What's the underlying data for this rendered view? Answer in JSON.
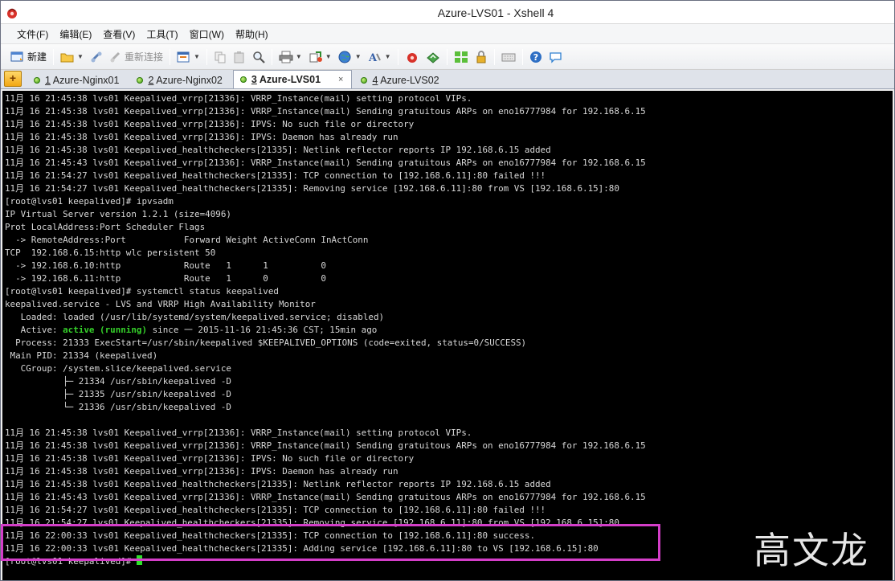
{
  "window": {
    "title": "Azure-LVS01 - Xshell 4"
  },
  "menu": [
    "文件(F)",
    "编辑(E)",
    "查看(V)",
    "工具(T)",
    "窗口(W)",
    "帮助(H)"
  ],
  "toolbar": {
    "new_label": "新建",
    "reconnect_label": "重新连接"
  },
  "tabs": [
    {
      "num": "1",
      "label": "Azure-Nginx01"
    },
    {
      "num": "2",
      "label": "Azure-Nginx02"
    },
    {
      "num": "3",
      "label": "Azure-LVS01",
      "active": true
    },
    {
      "num": "4",
      "label": "Azure-LVS02"
    }
  ],
  "tab_add_symbol": "+",
  "tab_close_symbol": "×",
  "terminal": {
    "lines": [
      "11月 16 21:45:38 lvs01 Keepalived_vrrp[21336]: VRRP_Instance(mail) setting protocol VIPs.",
      "11月 16 21:45:38 lvs01 Keepalived_vrrp[21336]: VRRP_Instance(mail) Sending gratuitous ARPs on eno16777984 for 192.168.6.15",
      "11月 16 21:45:38 lvs01 Keepalived_vrrp[21336]: IPVS: No such file or directory",
      "11月 16 21:45:38 lvs01 Keepalived_vrrp[21336]: IPVS: Daemon has already run",
      "11月 16 21:45:38 lvs01 Keepalived_healthcheckers[21335]: Netlink reflector reports IP 192.168.6.15 added",
      "11月 16 21:45:43 lvs01 Keepalived_vrrp[21336]: VRRP_Instance(mail) Sending gratuitous ARPs on eno16777984 for 192.168.6.15",
      "11月 16 21:54:27 lvs01 Keepalived_healthcheckers[21335]: TCP connection to [192.168.6.11]:80 failed !!!",
      "11月 16 21:54:27 lvs01 Keepalived_healthcheckers[21335]: Removing service [192.168.6.11]:80 from VS [192.168.6.15]:80",
      "[root@lvs01 keepalived]# ipvsadm",
      "IP Virtual Server version 1.2.1 (size=4096)",
      "Prot LocalAddress:Port Scheduler Flags",
      "  -> RemoteAddress:Port           Forward Weight ActiveConn InActConn",
      "TCP  192.168.6.15:http wlc persistent 50",
      "  -> 192.168.6.10:http            Route   1      1          0",
      "  -> 192.168.6.11:http            Route   1      0          0",
      "[root@lvs01 keepalived]# systemctl status keepalived",
      "keepalived.service - LVS and VRRP High Availability Monitor",
      "   Loaded: loaded (/usr/lib/systemd/system/keepalived.service; disabled)",
      "   Active: ",
      "  Process: 21333 ExecStart=/usr/sbin/keepalived $KEEPALIVED_OPTIONS (code=exited, status=0/SUCCESS)",
      " Main PID: 21334 (keepalived)",
      "   CGroup: /system.slice/keepalived.service",
      "           ├─ 21334 /usr/sbin/keepalived -D",
      "           ├─ 21335 /usr/sbin/keepalived -D",
      "           └─ 21336 /usr/sbin/keepalived -D",
      "",
      "11月 16 21:45:38 lvs01 Keepalived_vrrp[21336]: VRRP_Instance(mail) setting protocol VIPs.",
      "11月 16 21:45:38 lvs01 Keepalived_vrrp[21336]: VRRP_Instance(mail) Sending gratuitous ARPs on eno16777984 for 192.168.6.15",
      "11月 16 21:45:38 lvs01 Keepalived_vrrp[21336]: IPVS: No such file or directory",
      "11月 16 21:45:38 lvs01 Keepalived_vrrp[21336]: IPVS: Daemon has already run",
      "11月 16 21:45:38 lvs01 Keepalived_healthcheckers[21335]: Netlink reflector reports IP 192.168.6.15 added",
      "11月 16 21:45:43 lvs01 Keepalived_vrrp[21336]: VRRP_Instance(mail) Sending gratuitous ARPs on eno16777984 for 192.168.6.15",
      "11月 16 21:54:27 lvs01 Keepalived_healthcheckers[21335]: TCP connection to [192.168.6.11]:80 failed !!!",
      "11月 16 21:54:27 lvs01 Keepalived_healthcheckers[21335]: Removing service [192.168.6.11]:80 from VS [192.168.6.15]:80",
      "11月 16 22:00:33 lvs01 Keepalived_healthcheckers[21335]: TCP connection to [192.168.6.11]:80 success.",
      "11月 16 22:00:33 lvs01 Keepalived_healthcheckers[21335]: Adding service [192.168.6.11]:80 to VS [192.168.6.15]:80",
      "[root@lvs01 keepalived]# "
    ],
    "active_status": "active (running)",
    "active_since": " since 一 2015-11-16 21:45:36 CST; 15min ago",
    "colors": {
      "background": "#000000",
      "text": "#d8d8d8",
      "status_green": "#35d02a",
      "highlight": "#d43ec8"
    }
  },
  "watermark": "高文龙"
}
